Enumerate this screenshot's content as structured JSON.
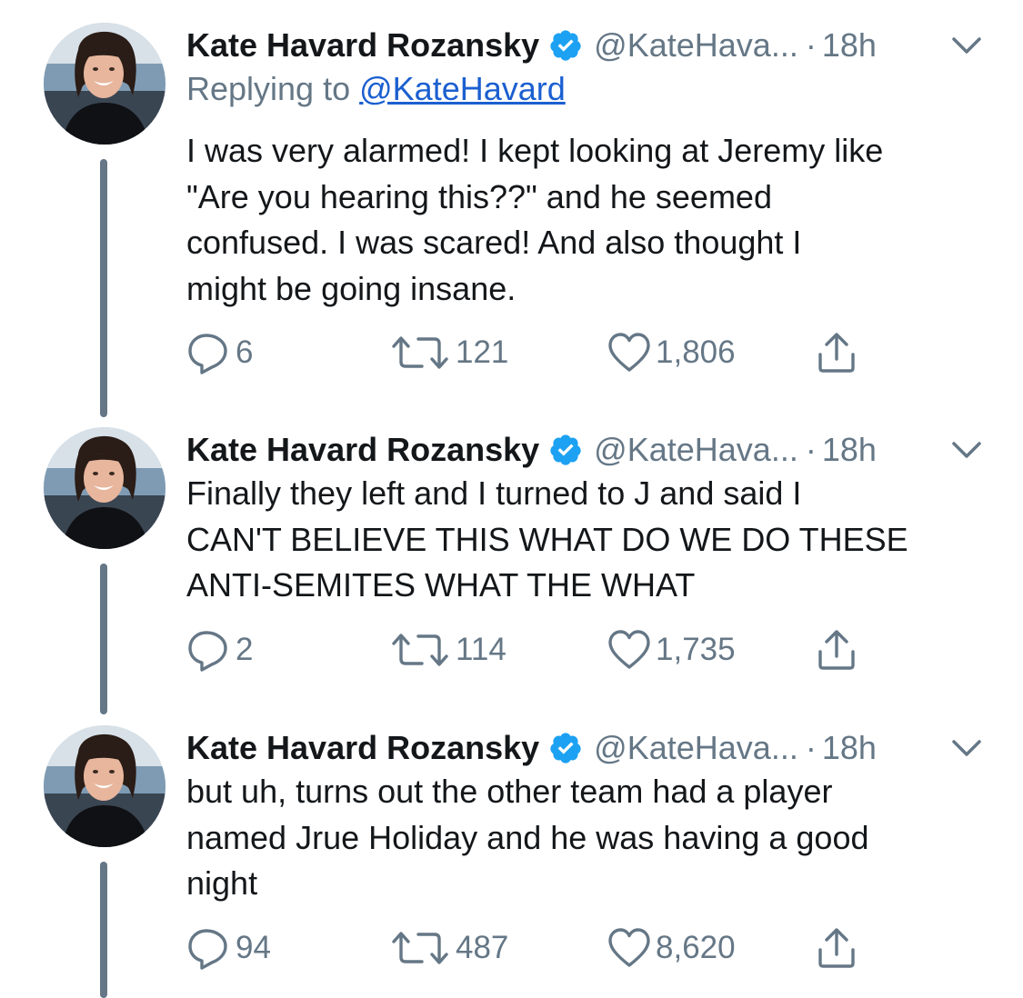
{
  "tweets": [
    {
      "name": "Kate Havard Rozansky",
      "handle": "@KateHava...",
      "time": "18h",
      "replying_prefix": "Replying to ",
      "replying_handle": "@KateHavard",
      "text": "I was very alarmed! I kept looking at Jeremy like\n\"Are you hearing this??\" and he seemed\nconfused. I was scared! And also thought I\nmight be going insane.",
      "replies": "6",
      "retweets": "121",
      "likes": "1,806"
    },
    {
      "name": "Kate Havard Rozansky",
      "handle": "@KateHava...",
      "time": "18h",
      "text": "Finally they left and I turned to J and said I\nCAN'T BELIEVE THIS WHAT DO WE DO THESE\nANTI-SEMITES WHAT THE WHAT",
      "replies": "2",
      "retweets": "114",
      "likes": "1,735"
    },
    {
      "name": "Kate Havard Rozansky",
      "handle": "@KateHava...",
      "time": "18h",
      "text": "but uh, turns out the other team had a player\nnamed Jrue Holiday and he was having a good\nnight",
      "replies": "94",
      "retweets": "487",
      "likes": "8,620"
    }
  ],
  "separator": "·",
  "icons": {
    "verified": "verified-badge-icon",
    "caret": "chevron-down-icon",
    "reply": "reply-bubble-icon",
    "retweet": "retweet-icon",
    "like": "heart-icon",
    "share": "share-icon"
  },
  "colors": {
    "text": "#14171a",
    "secondary": "#657786",
    "link": "#1b5fd0",
    "verified": "#1da1f2",
    "thread_line": "#657786"
  }
}
